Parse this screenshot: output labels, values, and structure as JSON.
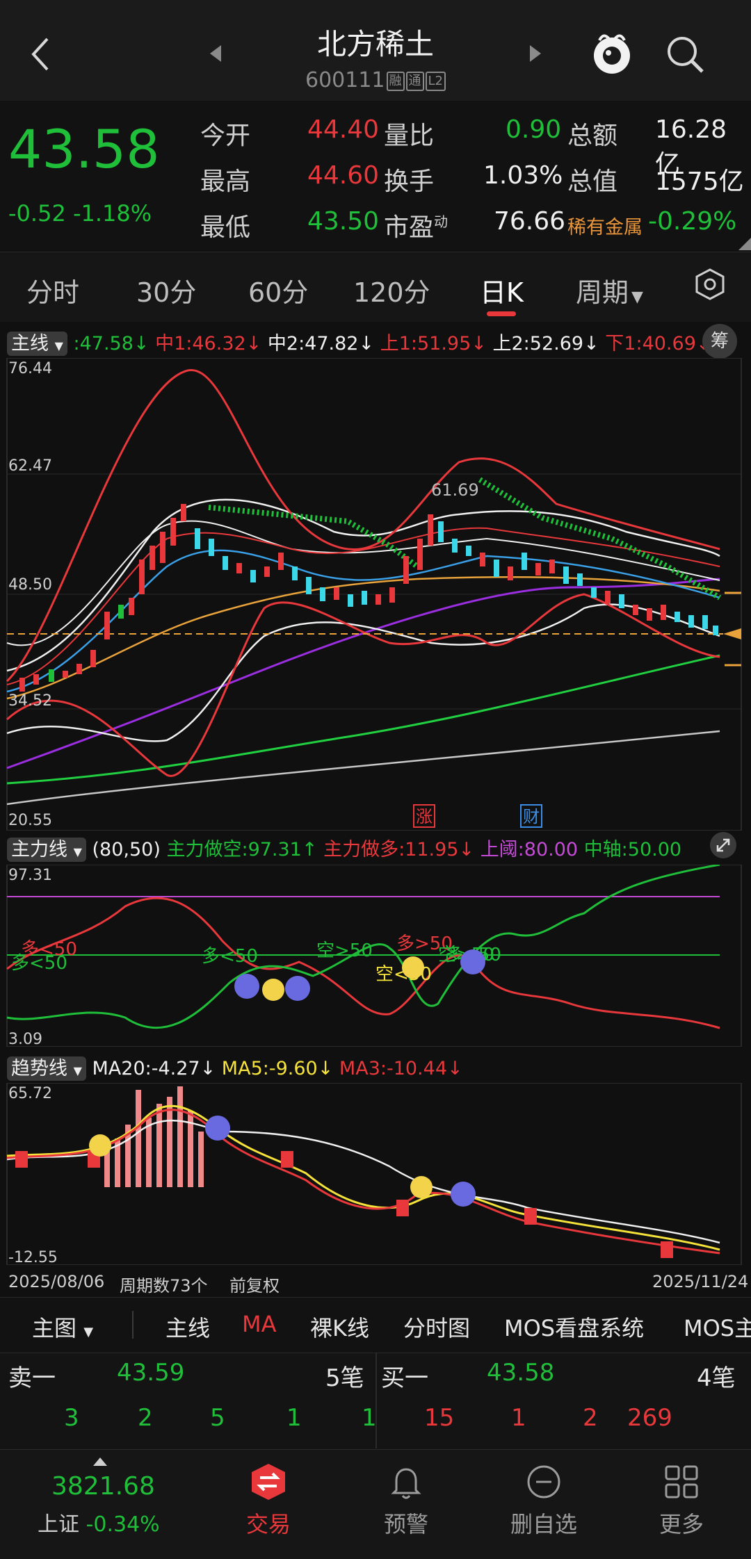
{
  "header": {
    "title": "北方稀土",
    "code": "600111",
    "badges": [
      "融",
      "通",
      "L2"
    ]
  },
  "quote": {
    "price": "43.58",
    "change": "-0.52",
    "change_pct": "-1.18%",
    "rows": [
      {
        "l1": "今开",
        "v1": "44.40",
        "l2": "量比",
        "v2": "0.90",
        "l3": "总额",
        "v3": "16.28亿"
      },
      {
        "l1": "最高",
        "v1": "44.60",
        "l2": "换手",
        "v2": "1.03%",
        "l3": "总值",
        "v3": "1575亿"
      },
      {
        "l1": "最低",
        "v1": "43.50",
        "l2": "市盈",
        "l2sup": "动",
        "v2": "76.66",
        "l3": "稀有金属",
        "v3": "-0.29%"
      }
    ]
  },
  "tabs": [
    "分时",
    "30分",
    "60分",
    "120分",
    "日K",
    "周期"
  ],
  "main_chart": {
    "label": "主线",
    "legend": [
      {
        "text": ":47.58↓",
        "color": "#1fbf3a"
      },
      {
        "text": "中1:46.32↓",
        "color": "#e8383b"
      },
      {
        "text": "中2:47.82↓",
        "color": "#f0f0f0"
      },
      {
        "text": "上1:51.95↓",
        "color": "#e8383b"
      },
      {
        "text": "上2:52.69↓",
        "color": "#f0f0f0"
      },
      {
        "text": "下1:40.69↓",
        "color": "#e8383b"
      }
    ],
    "chip": "筹",
    "y_labels": [
      "76.44",
      "62.47",
      "48.50",
      "34.52",
      "20.55"
    ],
    "high_label": "61.69",
    "events": [
      "涨",
      "财"
    ]
  },
  "force_chart": {
    "label": "主力线",
    "params": "(80,50)",
    "legend": [
      {
        "text": "主力做空:97.31↑",
        "color": "#1fbf3a"
      },
      {
        "text": "主力做多:11.95↓",
        "color": "#e8383b"
      },
      {
        "text": "上阈:80.00",
        "color": "#c44bd6"
      },
      {
        "text": "中轴:50.00",
        "color": "#1fbf3a"
      }
    ],
    "y_labels": [
      "97.31",
      "3.09"
    ],
    "annotations": [
      "多<50",
      "多<50",
      "多<50",
      "空>50",
      "多>50",
      "空<50",
      "空>50",
      "多<50"
    ]
  },
  "trend_chart": {
    "label": "趋势线",
    "legend": [
      {
        "text": "MA20:-4.27↓",
        "color": "#f0f0f0"
      },
      {
        "text": "MA5:-9.60↓",
        "color": "#f5e23a"
      },
      {
        "text": "MA3:-10.44↓",
        "color": "#e8383b"
      }
    ],
    "y_labels": [
      "65.72",
      "-12.55"
    ]
  },
  "footer_axis": {
    "start_date": "2025/08/06",
    "period_count": "周期数73个",
    "adjust": "前复权",
    "end_date": "2025/11/24"
  },
  "menu": [
    "主图",
    "主线",
    "MA",
    "裸K线",
    "分时图",
    "MOS看盘系统",
    "MOS主"
  ],
  "orderbook": {
    "sell_label": "卖一",
    "sell_price": "43.59",
    "sell_count": "5笔",
    "buy_label": "买一",
    "buy_price": "43.58",
    "buy_count": "4笔",
    "sell_queue": [
      "3",
      "2",
      "5",
      "1",
      "1"
    ],
    "buy_queue": [
      "15",
      "1",
      "2",
      "269"
    ]
  },
  "bottom_nav": {
    "index_value": "3821.68",
    "index_name": "上证",
    "index_change": "-0.34%",
    "items": [
      "交易",
      "预警",
      "删自选",
      "更多"
    ]
  },
  "colors": {
    "up": "#e8383b",
    "down": "#1fbf3a",
    "accent": "#e8383b",
    "ma_orange": "#e9a33a",
    "ma_purple": "#9b2ee0",
    "ma_green": "#20d040",
    "ma_blue": "#3aa0e8"
  }
}
